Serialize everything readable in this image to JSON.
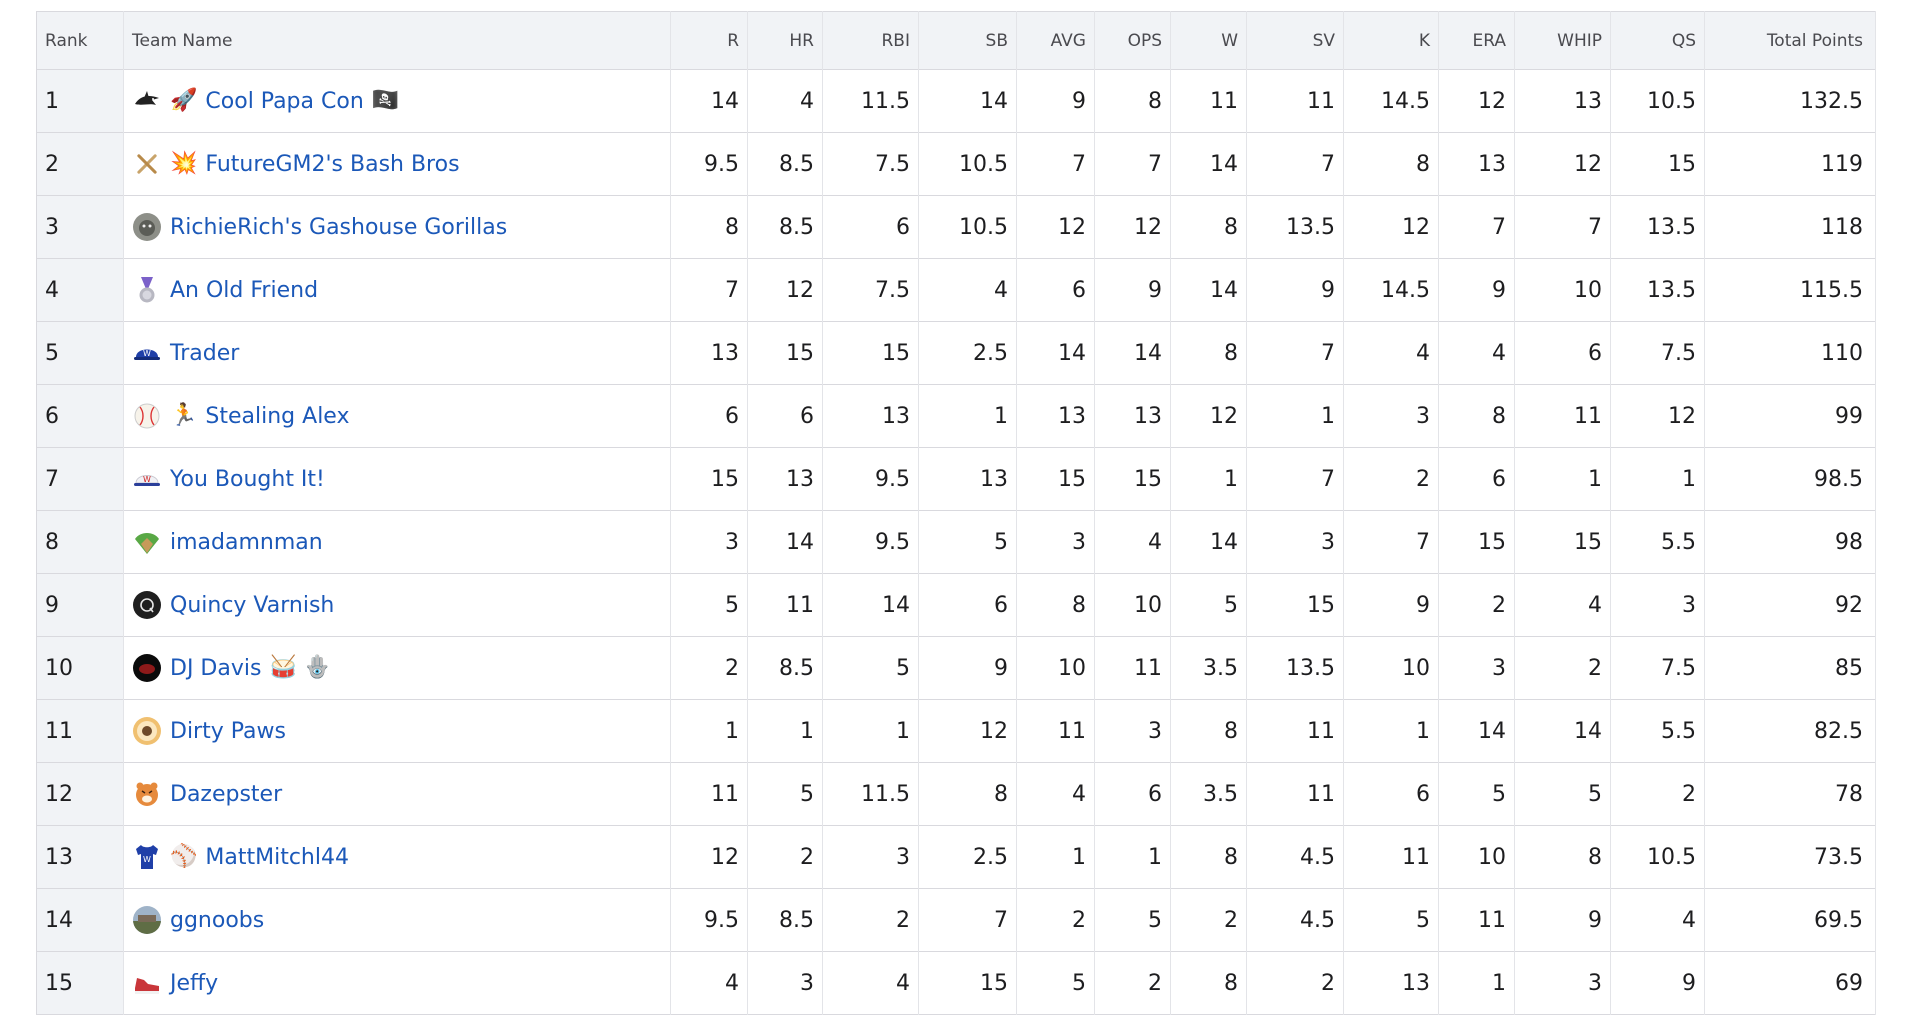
{
  "columns": {
    "rank": "Rank",
    "team": "Team Name",
    "stats": [
      "R",
      "HR",
      "RBI",
      "SB",
      "AVG",
      "OPS",
      "W",
      "SV",
      "K",
      "ERA",
      "WHIP",
      "QS"
    ],
    "total": "Total Points"
  },
  "colors": {
    "link": "#1b58b8",
    "header_bg": "#f1f3f6",
    "border": "#d9d9de"
  },
  "rows": [
    {
      "rank": "1",
      "icon": "shark-logo-icon",
      "lead": "🚀",
      "name": "Cool Papa Con",
      "trail": "🏴‍☠️",
      "stats": [
        "14",
        "4",
        "11.5",
        "14",
        "9",
        "8",
        "11",
        "11",
        "14.5",
        "12",
        "13",
        "10.5"
      ],
      "total": "132.5"
    },
    {
      "rank": "2",
      "icon": "crossed-bats-icon",
      "lead": "💥",
      "name": "FutureGM2's Bash Bros",
      "trail": "",
      "stats": [
        "9.5",
        "8.5",
        "7.5",
        "10.5",
        "7",
        "7",
        "14",
        "7",
        "8",
        "13",
        "12",
        "15"
      ],
      "total": "119"
    },
    {
      "rank": "3",
      "icon": "gorilla-avatar-icon",
      "lead": "",
      "name": "RichieRich's Gashouse Gorillas",
      "trail": "",
      "stats": [
        "8",
        "8.5",
        "6",
        "10.5",
        "12",
        "12",
        "8",
        "13.5",
        "12",
        "7",
        "7",
        "13.5"
      ],
      "total": "118"
    },
    {
      "rank": "4",
      "icon": "medal-icon",
      "lead": "",
      "name": "An Old Friend",
      "trail": "",
      "stats": [
        "7",
        "12",
        "7.5",
        "4",
        "6",
        "9",
        "14",
        "9",
        "14.5",
        "9",
        "10",
        "13.5"
      ],
      "total": "115.5"
    },
    {
      "rank": "5",
      "icon": "blue-cap-icon",
      "lead": "",
      "name": "Trader",
      "trail": "",
      "stats": [
        "13",
        "15",
        "15",
        "2.5",
        "14",
        "14",
        "8",
        "7",
        "4",
        "4",
        "6",
        "7.5"
      ],
      "total": "110"
    },
    {
      "rank": "6",
      "icon": "baseball-icon",
      "lead": "🏃",
      "name": "Stealing Alex",
      "trail": "",
      "stats": [
        "6",
        "6",
        "13",
        "1",
        "13",
        "13",
        "12",
        "1",
        "3",
        "8",
        "11",
        "12"
      ],
      "total": "99"
    },
    {
      "rank": "7",
      "icon": "white-cap-icon",
      "lead": "",
      "name": "You Bought It!",
      "trail": "",
      "stats": [
        "15",
        "13",
        "9.5",
        "13",
        "15",
        "15",
        "1",
        "7",
        "2",
        "6",
        "1",
        "1"
      ],
      "total": "98.5"
    },
    {
      "rank": "8",
      "icon": "ball-field-icon",
      "lead": "",
      "name": "imadamnman",
      "trail": "",
      "stats": [
        "3",
        "14",
        "9.5",
        "5",
        "3",
        "4",
        "14",
        "3",
        "7",
        "15",
        "15",
        "5.5"
      ],
      "total": "98"
    },
    {
      "rank": "9",
      "icon": "dark-q-avatar-icon",
      "lead": "",
      "name": "Quincy Varnish",
      "trail": "",
      "stats": [
        "5",
        "11",
        "14",
        "6",
        "8",
        "10",
        "5",
        "15",
        "9",
        "2",
        "4",
        "3"
      ],
      "total": "92"
    },
    {
      "rank": "10",
      "icon": "red-glow-avatar-icon",
      "lead": "",
      "name": "DJ Davis",
      "trail": "🥁 🪬",
      "stats": [
        "2",
        "8.5",
        "5",
        "9",
        "10",
        "11",
        "3.5",
        "13.5",
        "10",
        "3",
        "2",
        "7.5"
      ],
      "total": "85"
    },
    {
      "rank": "11",
      "icon": "paw-avatar-icon",
      "lead": "",
      "name": "Dirty Paws",
      "trail": "",
      "stats": [
        "1",
        "1",
        "1",
        "12",
        "11",
        "3",
        "8",
        "11",
        "1",
        "14",
        "14",
        "5.5"
      ],
      "total": "82.5"
    },
    {
      "rank": "12",
      "icon": "tiger-icon",
      "lead": "",
      "name": "Dazepster",
      "trail": "",
      "stats": [
        "11",
        "5",
        "11.5",
        "8",
        "4",
        "6",
        "3.5",
        "11",
        "6",
        "5",
        "5",
        "2"
      ],
      "total": "78"
    },
    {
      "rank": "13",
      "icon": "jersey-icon",
      "lead": "⚾",
      "name": "MattMitchl44",
      "trail": "",
      "stats": [
        "12",
        "2",
        "3",
        "2.5",
        "1",
        "1",
        "8",
        "4.5",
        "11",
        "10",
        "8",
        "10.5"
      ],
      "total": "73.5"
    },
    {
      "rank": "14",
      "icon": "landscape-avatar-icon",
      "lead": "",
      "name": "ggnoobs",
      "trail": "",
      "stats": [
        "9.5",
        "8.5",
        "2",
        "7",
        "2",
        "5",
        "2",
        "4.5",
        "5",
        "11",
        "9",
        "4"
      ],
      "total": "69.5"
    },
    {
      "rank": "15",
      "icon": "sneaker-icon",
      "lead": "",
      "name": "Jeffy",
      "trail": "",
      "stats": [
        "4",
        "3",
        "4",
        "15",
        "5",
        "2",
        "8",
        "2",
        "13",
        "1",
        "3",
        "9"
      ],
      "total": "69"
    }
  ]
}
